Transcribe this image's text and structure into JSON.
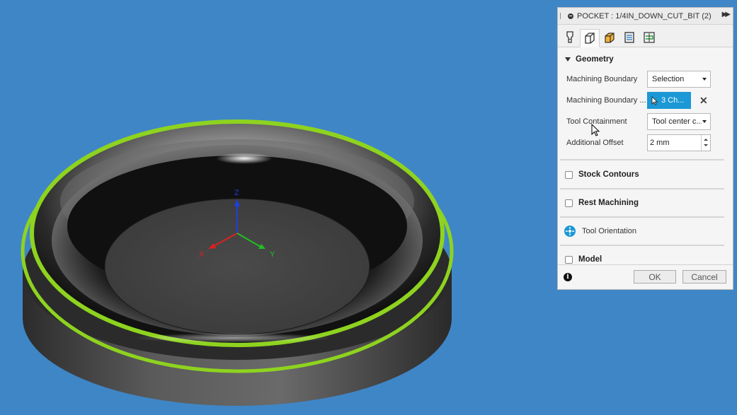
{
  "panel": {
    "title": "POCKET : 1/4IN_DOWN_CUT_BIT (2)",
    "tabs": [
      {
        "name": "tool-tab-icon"
      },
      {
        "name": "geometry-tab-icon",
        "active": true
      },
      {
        "name": "heights-tab-icon"
      },
      {
        "name": "passes-tab-icon"
      },
      {
        "name": "linking-tab-icon"
      }
    ],
    "geometry": {
      "heading": "Geometry",
      "machining_boundary_label": "Machining Boundary",
      "machining_boundary_value": "Selection",
      "boundary_selection_label": "Machining Boundary ...",
      "boundary_selection_value": "3 Ch...",
      "tool_containment_label": "Tool Containment",
      "tool_containment_value": "Tool center c...",
      "additional_offset_label": "Additional Offset",
      "additional_offset_value": "2 mm"
    },
    "stock_contours_label": "Stock Contours",
    "rest_machining_label": "Rest Machining",
    "tool_orientation_label": "Tool Orientation",
    "model_label": "Model",
    "ok_label": "OK",
    "cancel_label": "Cancel"
  },
  "axes": {
    "x": "X",
    "y": "Y",
    "z": "Z"
  },
  "colors": {
    "background": "#3f86c7",
    "accent": "#1b98d5",
    "highlight_green": "#8ed31f"
  }
}
